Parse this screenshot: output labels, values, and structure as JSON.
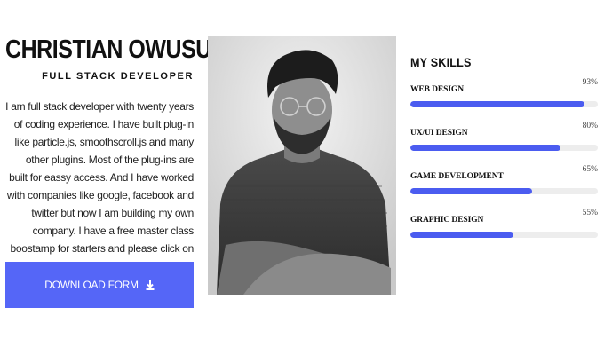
{
  "profile": {
    "name": "CHRISTIAN OWUSU",
    "role": "FULL STACK DEVELOPER",
    "bio": "I am full stack developer with twenty years of coding experience. I have built plug-in like particle.js, smoothscroll.js and many other plugins. Most of the plug-ins are built for eassy access. And I have worked with companies like google, facebook and twitter but now I am building my own company. I have a free master class boostamp for starters and please click on the button bellow to download your form.",
    "download_label": "DOWNLOAD FORM",
    "download_icon": "download-icon"
  },
  "skills": {
    "title": "MY SKILLS",
    "items": [
      {
        "label": "WEB DESIGN",
        "percent_label": "93%",
        "value": 93
      },
      {
        "label": "UX/UI DESIGN",
        "percent_label": "80%",
        "value": 80
      },
      {
        "label": "GAME DEVELOPMENT",
        "percent_label": "65%",
        "value": 65
      },
      {
        "label": "GRAPHIC DESIGN",
        "percent_label": "55%",
        "value": 55
      }
    ]
  },
  "colors": {
    "accent": "#4b5cf0",
    "button": "#5566f7",
    "track": "#ededed"
  }
}
